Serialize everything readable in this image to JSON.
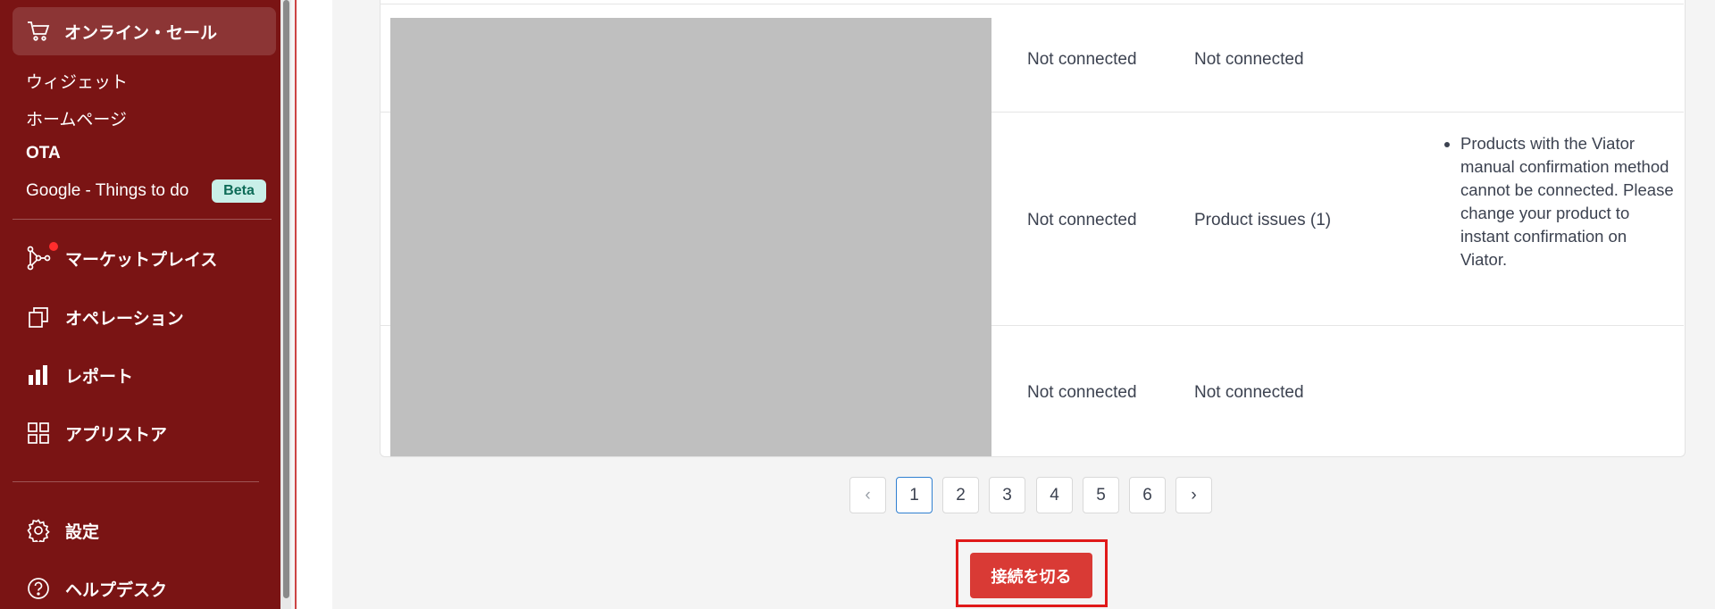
{
  "sidebar": {
    "top_item": {
      "label": "オンライン・セール",
      "icon": "cart-icon"
    },
    "sub_items": [
      {
        "label": "ウィジェット"
      },
      {
        "label": "ホームページ"
      },
      {
        "label": "OTA"
      },
      {
        "label": "Google - Things to do",
        "badge": "Beta"
      }
    ],
    "nav_items": [
      {
        "label": "マーケットプレイス",
        "icon": "network-icon"
      },
      {
        "label": "オペレーション",
        "icon": "copy-icon"
      },
      {
        "label": "レポート",
        "icon": "bar-chart-icon"
      },
      {
        "label": "アプリストア",
        "icon": "apps-icon"
      }
    ],
    "bottom_items": [
      {
        "label": "設定",
        "icon": "gear-icon"
      },
      {
        "label": "ヘルプデスク",
        "icon": "help-icon"
      }
    ]
  },
  "table": {
    "rows": [
      {
        "col1": "Not connected",
        "col2": "Not connected"
      },
      {
        "col1": "Not connected",
        "col2": "Product issues (1)",
        "issues": [
          "Products with the Viator manual confirmation method cannot be connected. Please change your product to instant confirmation on Viator."
        ]
      },
      {
        "col1": "Not connected",
        "col2": "Not connected"
      }
    ]
  },
  "pagination": {
    "prev": "‹",
    "next": "›",
    "pages": [
      "1",
      "2",
      "3",
      "4",
      "5",
      "6"
    ],
    "current": "1"
  },
  "actions": {
    "disconnect_label": "接続を切る"
  },
  "colors": {
    "sidebar": "#7a1414",
    "button": "#d93a35",
    "highlight": "#e01919",
    "active_page": "#2f7fd1"
  }
}
